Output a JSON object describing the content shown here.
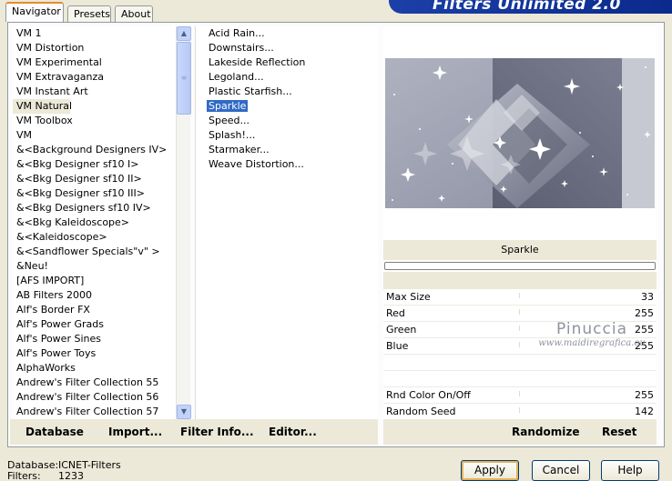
{
  "tabs": [
    {
      "label": "Navigator",
      "active": true
    },
    {
      "label": "Presets",
      "active": false
    },
    {
      "label": "About",
      "active": false
    }
  ],
  "banner": {
    "title": "Filters Unlimited 2.0"
  },
  "categories": [
    "VM 1",
    "VM Distortion",
    "VM Experimental",
    "VM Extravaganza",
    "VM Instant Art",
    "VM Natural",
    "VM Toolbox",
    "VM",
    "&<Background Designers IV>",
    "&<Bkg Designer sf10 I>",
    "&<Bkg Designer sf10 II>",
    "&<Bkg Designer sf10 III>",
    "&<Bkg Designers sf10 IV>",
    "&<Bkg Kaleidoscope>",
    "&<Kaleidoscope>",
    "&<Sandflower Specials\"v\" >",
    "&Neu!",
    "[AFS IMPORT]",
    "AB Filters 2000",
    "Alf's Border FX",
    "Alf's Power Grads",
    "Alf's Power Sines",
    "Alf's Power Toys",
    "AlphaWorks",
    "Andrew's Filter Collection 55",
    "Andrew's Filter Collection 56",
    "Andrew's Filter Collection 57"
  ],
  "selected_category": "VM Natural",
  "filters": [
    "Acid Rain...",
    "Downstairs...",
    "Lakeside Reflection",
    "Legoland...",
    "Plastic Starfish...",
    "Sparkle",
    "Speed...",
    "Splash!...",
    "Starmaker...",
    "Weave Distortion..."
  ],
  "selected_filter": "Sparkle",
  "filter_name": "Sparkle",
  "params": [
    {
      "label": "Max Size",
      "value": "33"
    },
    {
      "label": "Red",
      "value": "255"
    },
    {
      "label": "Green",
      "value": "255"
    },
    {
      "label": "Blue",
      "value": "255"
    },
    {
      "label": "",
      "value": ""
    },
    {
      "label": "",
      "value": ""
    },
    {
      "label": "Rnd Color On/Off",
      "value": "255"
    },
    {
      "label": "Random Seed",
      "value": "142"
    }
  ],
  "watermark": {
    "line1": "Pinuccia",
    "line2": "www.maidiregrafica.eu"
  },
  "left_buttons": {
    "database": "Database",
    "import": "Import...",
    "filter_info": "Filter Info...",
    "editor": "Editor..."
  },
  "right_buttons": {
    "randomize": "Randomize",
    "reset": "Reset"
  },
  "status": {
    "database_label": "Database:",
    "database_value": "ICNET-Filters",
    "filters_label": "Filters:",
    "filters_value": "1233"
  },
  "dialog": {
    "apply": "Apply",
    "cancel": "Cancel",
    "help": "Help"
  },
  "colors": {
    "selection": "#316ac5",
    "window_bg": "#ece9d8",
    "banner": "#0a2a8c"
  }
}
